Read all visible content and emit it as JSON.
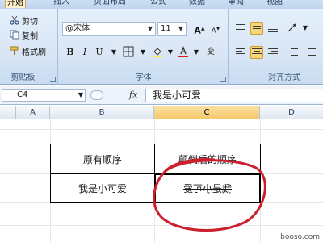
{
  "ribbon": {
    "tabs": [
      "开始",
      "插入",
      "页面布局",
      "公式",
      "数据",
      "审阅",
      "视图"
    ],
    "clipboard": {
      "cut": "剪切",
      "copy": "复制",
      "format_painter": "格式刷",
      "label": "剪贴板"
    },
    "font": {
      "name": "@宋体",
      "size": "11",
      "grow": "A",
      "shrink": "A",
      "bold": "B",
      "italic": "I",
      "underline": "U",
      "phonetic": "变",
      "label": "字体"
    },
    "alignment": {
      "label": "对齐方式"
    }
  },
  "formula_bar": {
    "name_box": "C4",
    "fx": "fx",
    "content": "我是小可爱"
  },
  "columns": [
    "A",
    "B",
    "C",
    "D"
  ],
  "table": {
    "header_original": "原有顺序",
    "header_reversed": "颠倒后的顺序",
    "original_value": "我是小可爱",
    "reversed_value": "我是小可爱"
  },
  "watermark": "booso.com",
  "colors": {
    "annotation_circle": "#cc1f2d",
    "active_tab": "#fff2cc",
    "selected_header": "#f5c768"
  }
}
